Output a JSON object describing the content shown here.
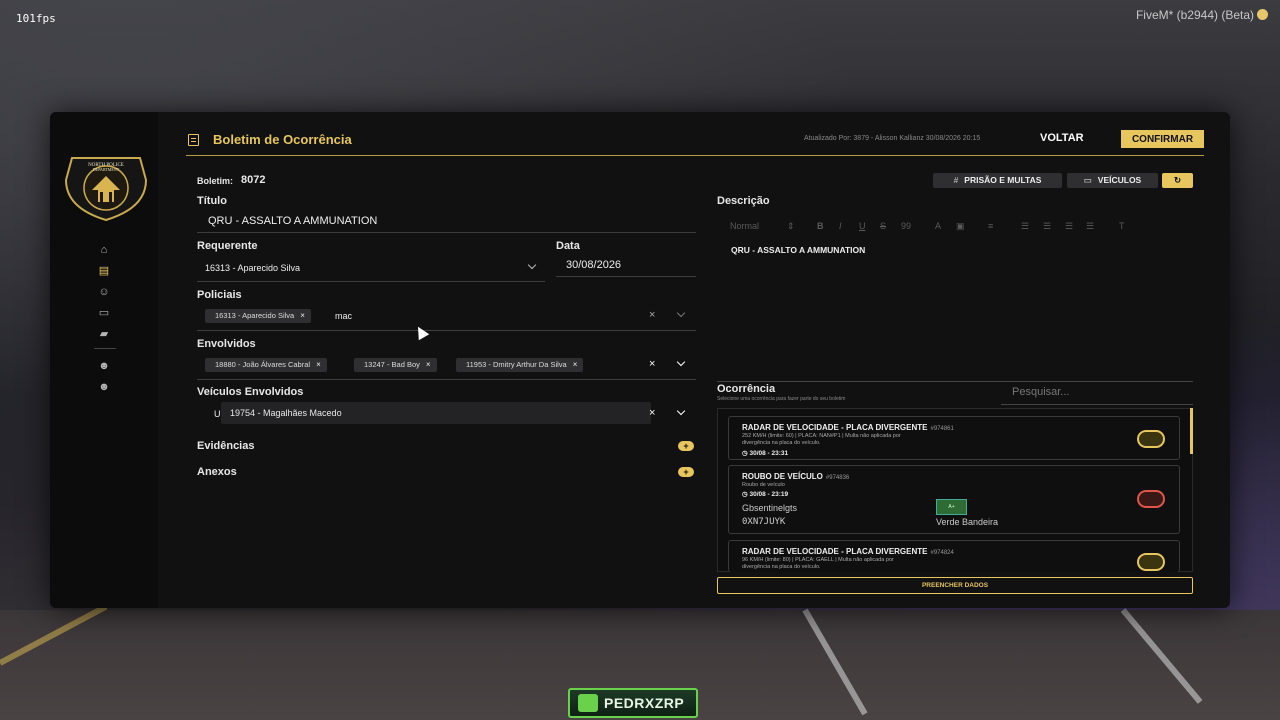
{
  "overlay": {
    "fps": "101fps",
    "build": "FiveM* (b2944) (Beta)"
  },
  "sidebar": {
    "logo_text": "NORTH POLICE DEPARTMENT",
    "items": [
      "home-icon",
      "report-icon",
      "people-icon",
      "vehicle-icon",
      "weapon-icon",
      "user-settings-icon",
      "user-add-icon"
    ]
  },
  "header": {
    "title": "Boletim de Ocorrência",
    "updated": "Atualizado Por: 3879 - Alisson Kallianz 30/08/2026 20:15",
    "back_label": "VOLTAR",
    "confirm_label": "CONFIRMAR"
  },
  "form": {
    "boletim_label": "Boletim:",
    "boletim_number": "8072",
    "titulo_label": "Título",
    "titulo_value": "QRU - ASSALTO A  AMMUNATION",
    "requerente_label": "Requerente",
    "requerente_value": "16313 - Aparecido Silva",
    "data_label": "Data",
    "data_value": "30/08/2026",
    "policiais_label": "Policiais",
    "policiais_chips": [
      "16313 - Aparecido Silva"
    ],
    "policiais_typed": "mac",
    "envolvidos_label": "Envolvidos",
    "envolvidos_chips": [
      "18880 - João Álvares Cabral",
      "13247 - Bad Boy",
      "11953 - Dmitry Arthur Da Silva"
    ],
    "veiculos_label": "Veículos Envolvidos",
    "veiculos_partial": "U",
    "dropdown_option": "19754 - Magalhães Macedo",
    "evidencias_label": "Evidências",
    "anexos_label": "Anexos",
    "plus": "+",
    "chip_remove": "×",
    "clear": "×"
  },
  "actions": {
    "prisao_label": "PRISÃO E MULTAS",
    "veiculos_label": "VEÍCULOS",
    "hash": "#"
  },
  "descricao": {
    "label": "Descrição",
    "toolbar": {
      "normal": "Normal",
      "bold": "B",
      "italic": "I",
      "underline": "U",
      "strike": "S",
      "quote": "99"
    },
    "content": "QRU - ASSALTO A AMMUNATION"
  },
  "ocorrencia": {
    "label": "Ocorrência",
    "hint": "Selecione uma ocorrência para fazer parte do seu boletim",
    "search_placeholder": "Pesquisar...",
    "fill_label": "PREENCHER DADOS",
    "items": [
      {
        "title": "RADAR DE VELOCIDADE - PLACA DIVERGENTE",
        "id": "#974861",
        "desc": "252 KM/H (limite: 60) | PLACA: NAN#P1 | Multa não aplicada por divergência na placa do veículo.",
        "time": "30/08 - 23:31",
        "badge_color": "#e7c65d"
      },
      {
        "title": "ROUBO DE VEÍCULO",
        "id": "#974836",
        "desc": "Roubo de veículo",
        "time": "30/08 - 23:19",
        "vehicle": "Gbsentinelgts",
        "plate": "0XN7JUYK",
        "color_name": "Verde Bandeira",
        "color_swatch": "#2f6b35",
        "swatch_text": "A+",
        "badge_color": "#e0574a"
      },
      {
        "title": "RADAR DE VELOCIDADE - PLACA DIVERGENTE",
        "id": "#974824",
        "desc": "96 KM/H (limite: 80) | PLACA: GAELL | Multa não aplicada por divergência na placa do veículo.",
        "badge_color": "#e7c65d"
      }
    ]
  },
  "watermark": "PEDRXZRP"
}
